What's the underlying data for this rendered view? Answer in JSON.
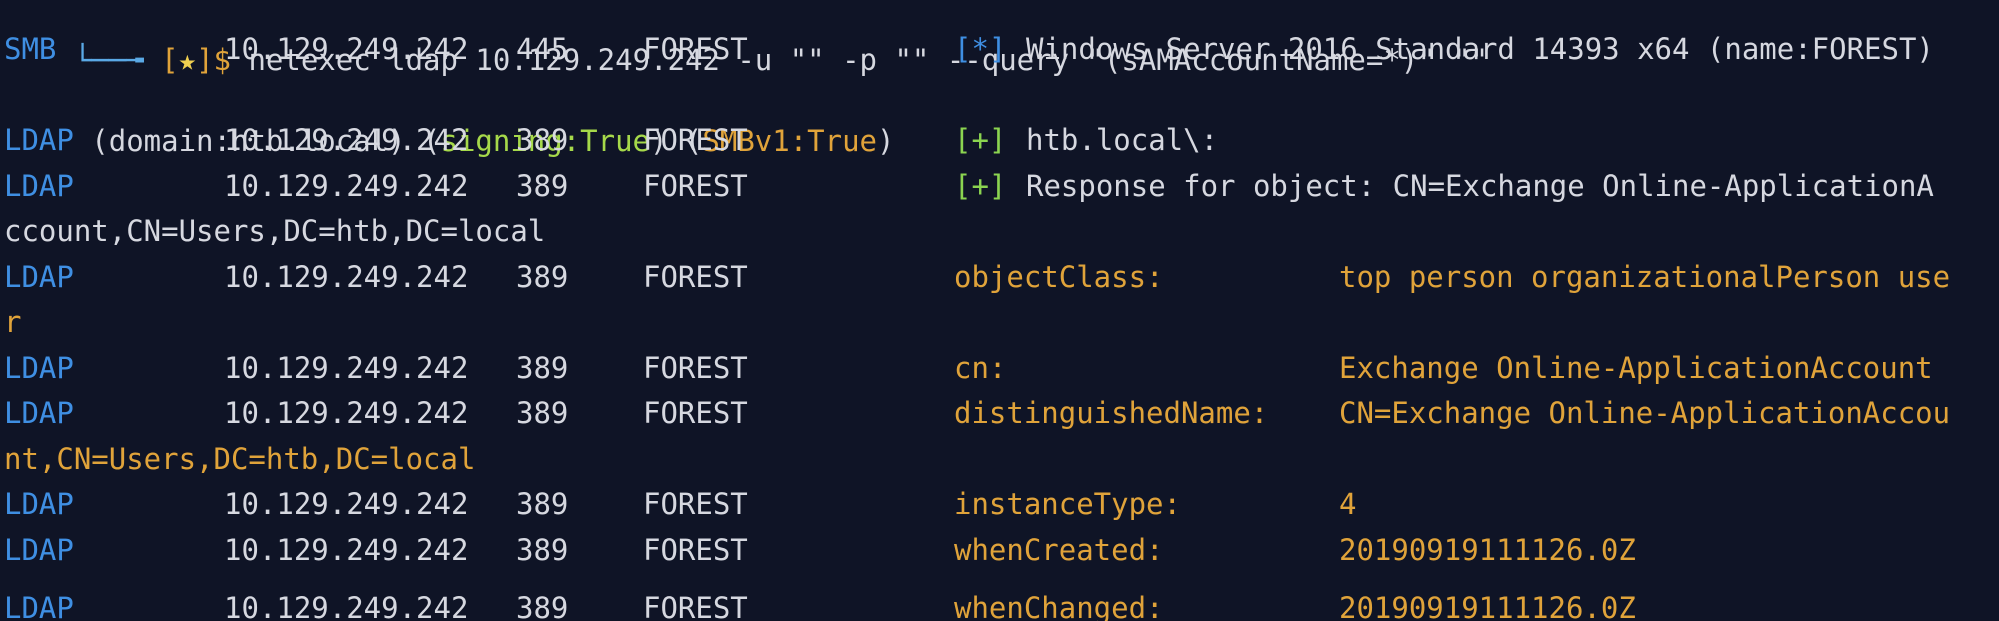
{
  "prompt": {
    "corner": "└──╼",
    "bracket_open": " [",
    "star": "★",
    "bracket_close": "]$",
    "command": " netexec ldap 10.129.249.242 -u \"\" -p \"\" --query \"(sAMAccountName=*)\" \"\""
  },
  "rows": [
    {
      "proto": "SMB",
      "ip": "10.129.249.242",
      "port": "445",
      "host": "FOREST",
      "tag": "[*]",
      "msg": "Windows Server 2016 Standard 14393 x64 (name:FOREST)"
    },
    {
      "proto": "LDAP",
      "ip": "10.129.249.242",
      "port": "389",
      "host": "FOREST",
      "tag": "[+]",
      "msg": "htb.local\\:"
    },
    {
      "proto": "LDAP",
      "ip": "10.129.249.242",
      "port": "389",
      "host": "FOREST",
      "tag": "[+]",
      "msg": "Response for object: CN=Exchange Online-ApplicationA"
    },
    {
      "proto": "LDAP",
      "ip": "10.129.249.242",
      "port": "389",
      "host": "FOREST",
      "attr": "objectClass:",
      "value": "top person organizationalPerson use"
    },
    {
      "proto": "LDAP",
      "ip": "10.129.249.242",
      "port": "389",
      "host": "FOREST",
      "attr": "cn:",
      "value": "Exchange Online-ApplicationAccount"
    },
    {
      "proto": "LDAP",
      "ip": "10.129.249.242",
      "port": "389",
      "host": "FOREST",
      "attr": "distinguishedName:",
      "value": "CN=Exchange Online-ApplicationAccou"
    },
    {
      "proto": "LDAP",
      "ip": "10.129.249.242",
      "port": "389",
      "host": "FOREST",
      "attr": "instanceType:",
      "value": "4"
    },
    {
      "proto": "LDAP",
      "ip": "10.129.249.242",
      "port": "389",
      "host": "FOREST",
      "attr": "whenCreated:",
      "value": "20190919111126.0Z"
    },
    {
      "proto": "LDAP",
      "ip": "10.129.249.242",
      "port": "389",
      "host": "FOREST",
      "attr": "whenChanged:",
      "value": "20190919111126.0Z"
    }
  ],
  "wraps": {
    "smb_domain": " (domain:htb.local) (",
    "smb_signing": "signing:True",
    "smb_mid": ") (",
    "smb_v1": "SMBv1:True",
    "smb_end": ")",
    "response_cont": "ccount,CN=Users,DC=htb,DC=local",
    "objectclass_cont": "r",
    "dn_cont": "nt,CN=Users,DC=htb,DC=local"
  },
  "colors": {
    "background": "#0f1426",
    "protocol_blue": "#3f8fe3",
    "success_green": "#8bd450",
    "attribute_orange": "#e0a33a",
    "text": "#d6d8e0"
  }
}
